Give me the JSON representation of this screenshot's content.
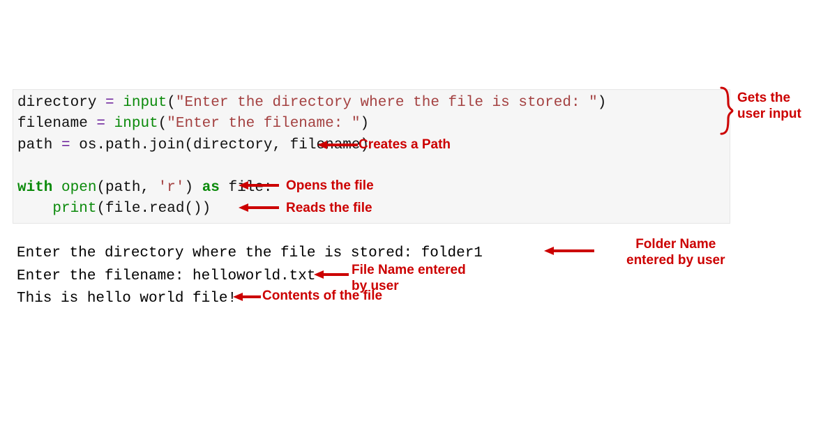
{
  "code": {
    "l1_var": "directory ",
    "l1_eq": "= ",
    "l1_fn": "input",
    "l1_paren_o": "(",
    "l1_str": "\"Enter the directory where the file is stored: \"",
    "l1_paren_c": ")",
    "l2_var": "filename ",
    "l2_eq": "= ",
    "l2_fn": "input",
    "l2_paren_o": "(",
    "l2_str": "\"Enter the filename: \"",
    "l2_paren_c": ")",
    "l3_var": "path ",
    "l3_eq": "= ",
    "l3_rest": "os.path.join(directory, filename)",
    "l5_with": "with ",
    "l5_open": "open",
    "l5_paren_o": "(",
    "l5_arg1": "path, ",
    "l5_str": "'r'",
    "l5_paren_c": ") ",
    "l5_as": "as ",
    "l5_file": "file:",
    "l6_indent": "    ",
    "l6_print": "print",
    "l6_rest": "(file.read())"
  },
  "output": {
    "l1": "Enter the directory where the file is stored: folder1",
    "l2": "Enter the filename: helloworld.txt",
    "l3": "This is hello world file!"
  },
  "annotations": {
    "gets_input": "Gets the\nuser input",
    "creates_path": "Creates a Path",
    "opens_file": "Opens the file",
    "reads_file": "Reads the file",
    "folder_name": "Folder Name\nentered by user",
    "file_name": "File Name entered\nby user",
    "contents": "Contents of the file"
  }
}
